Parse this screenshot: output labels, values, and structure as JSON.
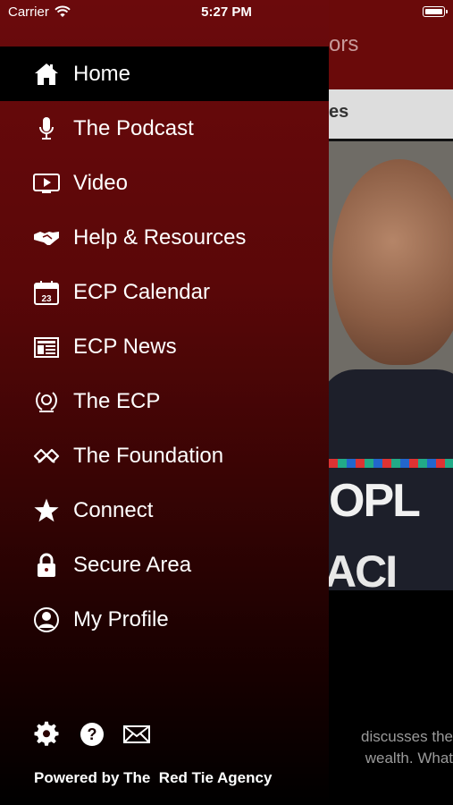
{
  "status_bar": {
    "carrier": "Carrier",
    "time": "5:27 PM"
  },
  "background": {
    "header_title": "ors",
    "tab_label": "es",
    "tee_line1": "OPL",
    "tee_line2": "ACI",
    "body_text": "discusses the wealth. What"
  },
  "menu": {
    "items": [
      {
        "label": "Home",
        "icon": "home-icon"
      },
      {
        "label": "The Podcast",
        "icon": "microphone-icon"
      },
      {
        "label": "Video",
        "icon": "video-icon"
      },
      {
        "label": "Help & Resources",
        "icon": "handshake-icon"
      },
      {
        "label": "ECP Calendar",
        "icon": "calendar-icon",
        "calendar_day": "23"
      },
      {
        "label": "ECP News",
        "icon": "newspaper-icon"
      },
      {
        "label": "The ECP",
        "icon": "ecp-logo-icon"
      },
      {
        "label": "The Foundation",
        "icon": "foundation-icon"
      },
      {
        "label": "Connect",
        "icon": "star-icon"
      },
      {
        "label": "Secure Area",
        "icon": "lock-icon"
      },
      {
        "label": "My Profile",
        "icon": "profile-icon"
      }
    ],
    "active_index": 0
  },
  "footer": {
    "icons": [
      "gear-icon",
      "help-icon",
      "mail-icon"
    ],
    "help_glyph": "?",
    "powered_by": "Powered by The  Red Tie Agency"
  }
}
